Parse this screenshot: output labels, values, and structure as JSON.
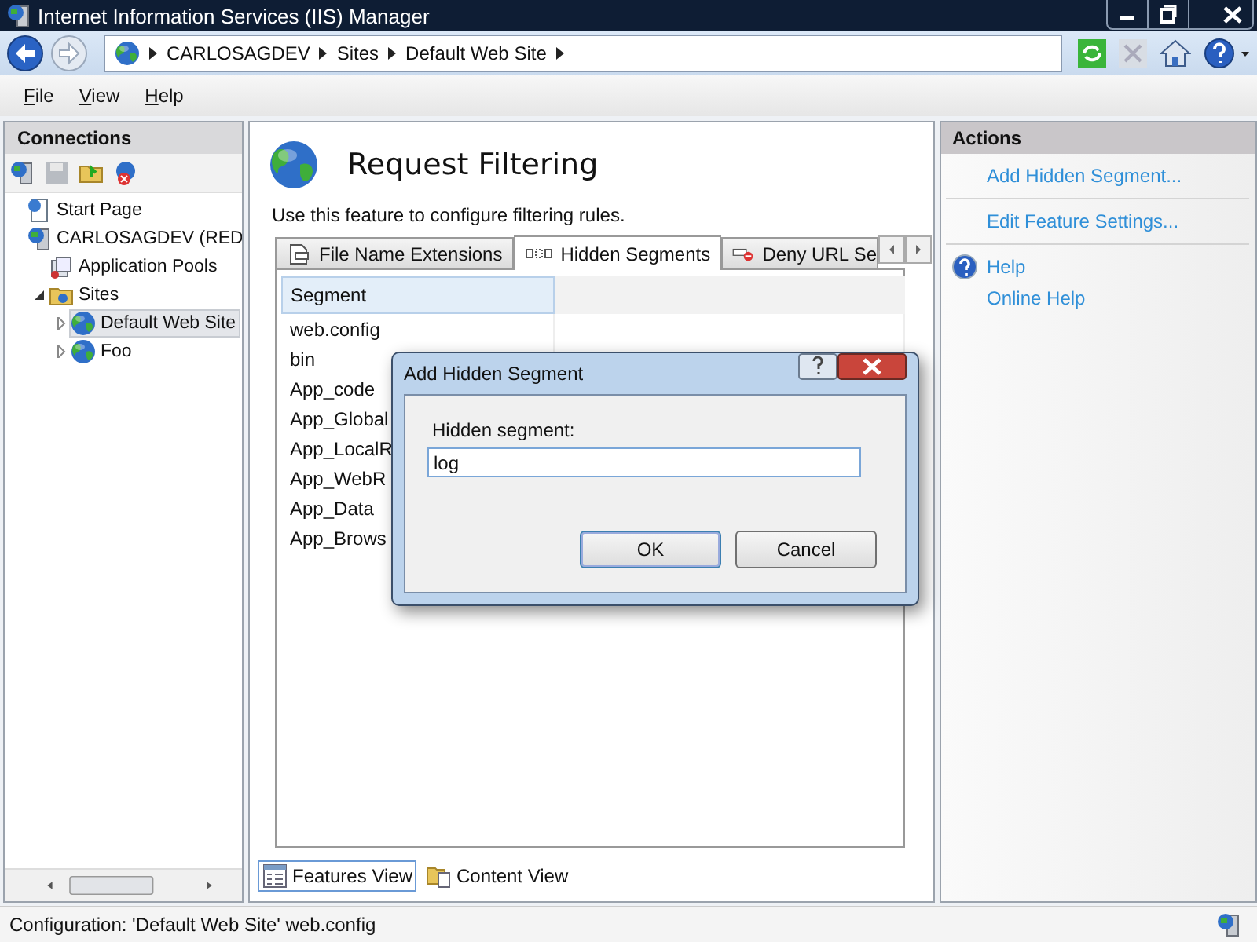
{
  "window": {
    "title": "Internet Information Services (IIS) Manager"
  },
  "address": {
    "crumbs": [
      "CARLOSAGDEV",
      "Sites",
      "Default Web Site"
    ]
  },
  "menu": [
    "File",
    "View",
    "Help"
  ],
  "connections": {
    "title": "Connections",
    "tree": [
      {
        "label": "Start Page",
        "kind": "page",
        "selected": false
      },
      {
        "label": "CARLOSAGDEV (RED",
        "kind": "server",
        "selected": false,
        "children": [
          {
            "label": "Application Pools",
            "kind": "pool",
            "selected": false
          },
          {
            "label": "Sites",
            "kind": "folder",
            "selected": false,
            "expanded": true,
            "children": [
              {
                "label": "Default Web Site",
                "kind": "site",
                "selected": true,
                "expanded": false
              },
              {
                "label": "Foo",
                "kind": "site",
                "selected": false,
                "expanded": false
              }
            ]
          }
        ]
      }
    ]
  },
  "feature": {
    "title": "Request Filtering",
    "description": "Use this feature to configure filtering rules.",
    "tabs": [
      {
        "label": "File Name Extensions",
        "kind": "doc",
        "selected": false
      },
      {
        "label": "Hidden Segments",
        "kind": "segments",
        "selected": true
      },
      {
        "label": "Deny URL Se",
        "kind": "deny",
        "selected": false
      }
    ],
    "table": {
      "columns": [
        "Segment"
      ],
      "rows": [
        "web.config",
        "bin",
        "App_code",
        "App_Global",
        "App_LocalR",
        "App_WebR",
        "App_Data",
        "App_Brows"
      ]
    },
    "views": [
      {
        "label": "Features View",
        "kind": "features",
        "selected": true
      },
      {
        "label": "Content View",
        "kind": "content",
        "selected": false
      }
    ]
  },
  "actions": {
    "title": "Actions",
    "groups": [
      [
        {
          "label": "Add Hidden Segment...",
          "kind": "link"
        }
      ],
      [
        {
          "label": "Edit Feature Settings...",
          "kind": "link"
        }
      ],
      [
        {
          "label": "Help",
          "kind": "help"
        },
        {
          "label": "Online Help",
          "kind": "link"
        }
      ]
    ]
  },
  "dialog": {
    "title": "Add Hidden Segment",
    "field_label": "Hidden segment:",
    "value": "log",
    "buttons": [
      {
        "label": "OK",
        "default": true
      },
      {
        "label": "Cancel",
        "default": false
      }
    ]
  },
  "status_bar": {
    "text": "Configuration: 'Default Web Site' web.config"
  }
}
